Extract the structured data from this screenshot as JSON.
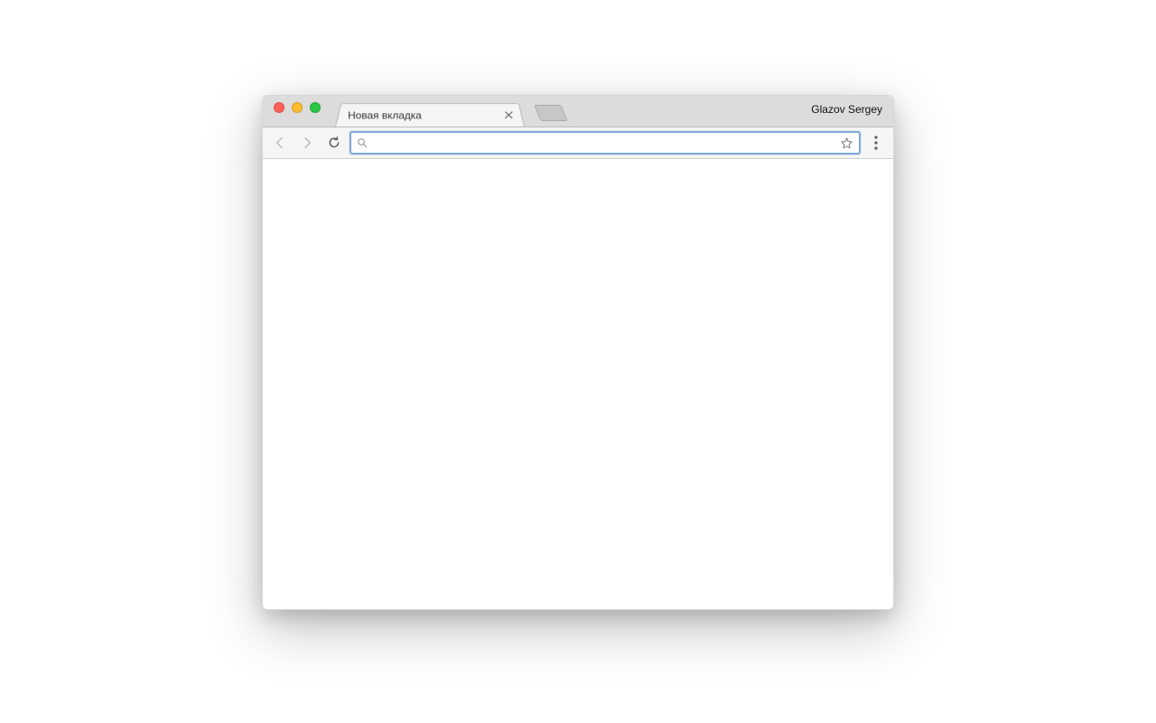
{
  "tabstrip": {
    "active_tab_title": "Новая вкладка",
    "profile_name": "Glazov Sergey"
  },
  "toolbar": {
    "address_value": "",
    "address_placeholder": ""
  },
  "icons": {
    "close": "close-icon",
    "new_tab": "new-tab-icon",
    "back": "arrow-left-icon",
    "forward": "arrow-right-icon",
    "reload": "reload-icon",
    "search": "search-icon",
    "star": "star-icon",
    "menu": "menu-dots-icon"
  }
}
